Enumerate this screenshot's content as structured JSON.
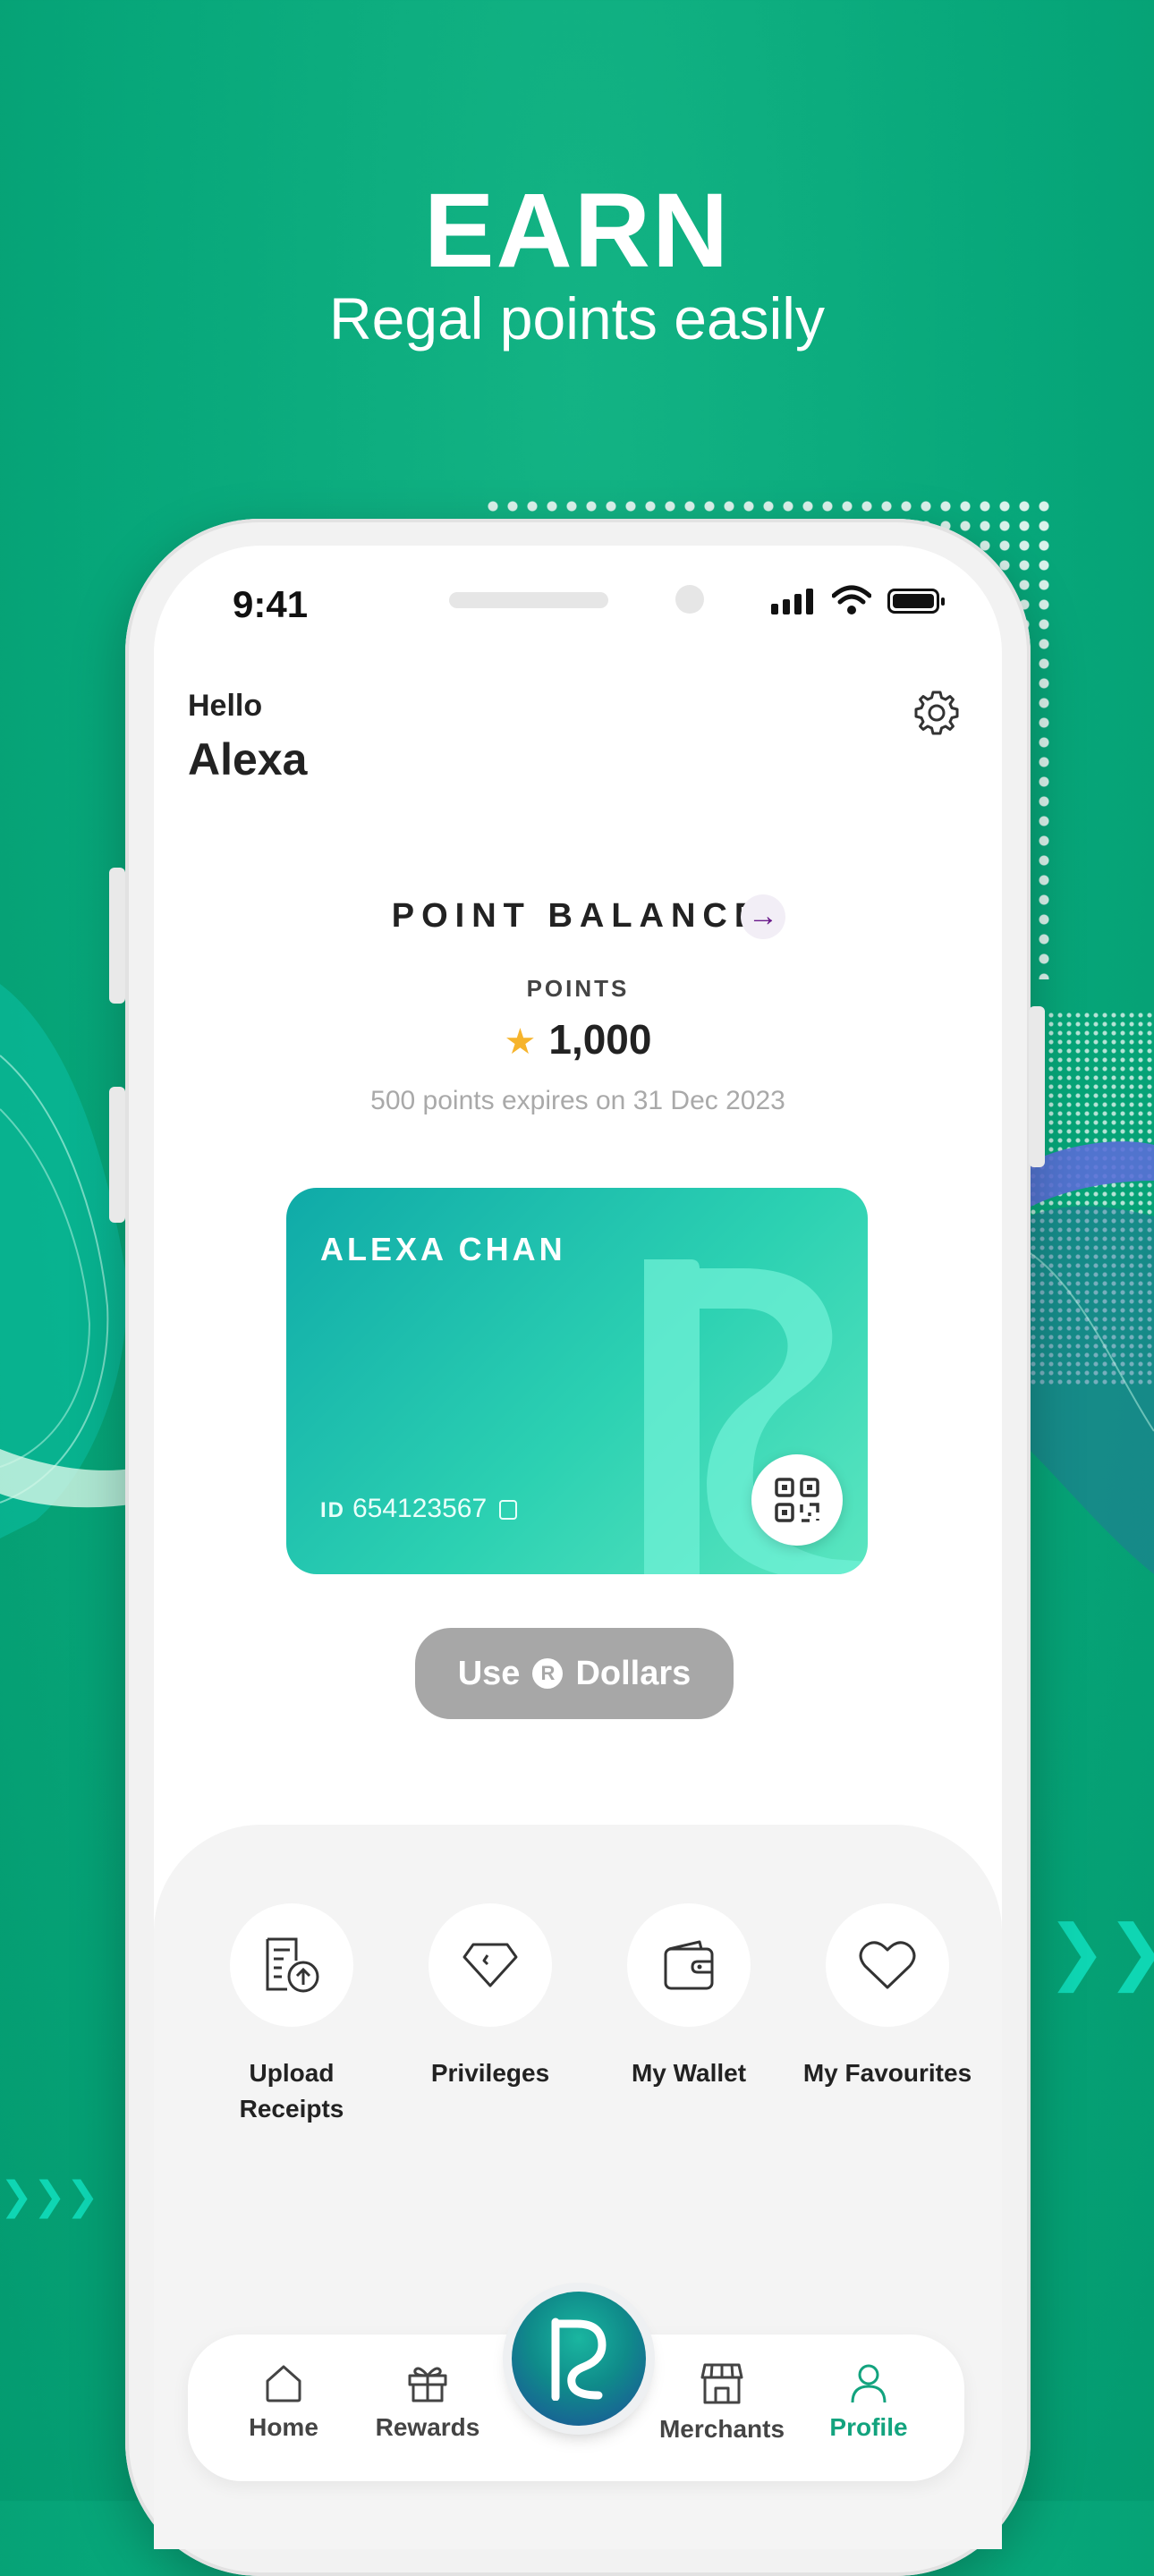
{
  "promo": {
    "title": "EARN",
    "subtitle": "Regal points easily"
  },
  "status_bar": {
    "time": "9:41"
  },
  "greeting": {
    "hello": "Hello",
    "name": "Alexa"
  },
  "balance": {
    "title": "POINT BALANCE",
    "points_label": "POINTS",
    "points_value": "1,000",
    "expiry_note": "500 points expires on 31 Dec 2023"
  },
  "card": {
    "holder": "ALEXA CHAN",
    "id_label": "ID",
    "id_value": "654123567"
  },
  "use_button": {
    "prefix": "Use",
    "symbol": "R",
    "suffix": "Dollars"
  },
  "shortcuts": [
    {
      "label": "Upload Receipts",
      "icon": "upload-receipt-icon"
    },
    {
      "label": "Privileges",
      "icon": "diamond-icon"
    },
    {
      "label": "My Wallet",
      "icon": "wallet-icon"
    },
    {
      "label": "My Favourites",
      "icon": "heart-icon"
    }
  ],
  "bottom_nav": {
    "items": [
      {
        "label": "Home",
        "icon": "home-icon"
      },
      {
        "label": "Rewards",
        "icon": "gift-icon"
      },
      {
        "label": "Merchants",
        "icon": "store-icon"
      },
      {
        "label": "Profile",
        "icon": "user-icon"
      }
    ],
    "active": "Profile"
  },
  "colors": {
    "background": "#07a77a",
    "accent": "#12a37e",
    "card_start": "#0faaa8",
    "card_end": "#5be6c0",
    "star": "#f6b42c",
    "button_disabled": "#a7a7a7"
  }
}
